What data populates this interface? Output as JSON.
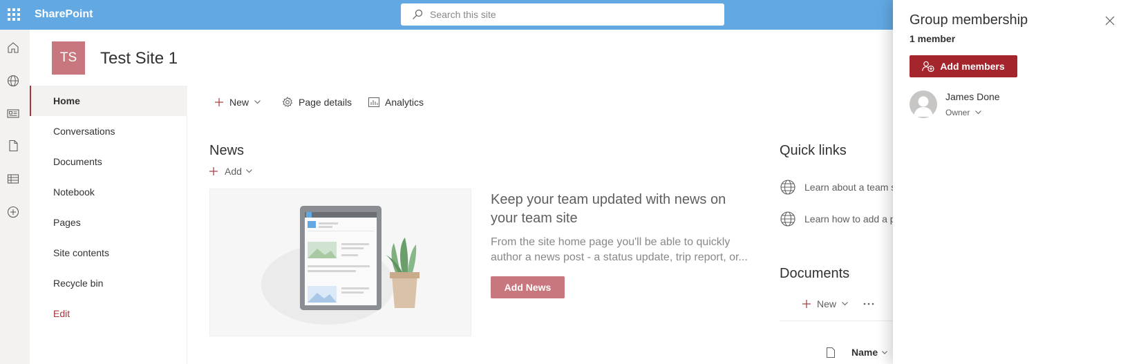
{
  "suite_bar": {
    "app_name": "SharePoint",
    "search_placeholder": "Search this site",
    "icons": [
      "app-launcher-icon",
      "search-icon"
    ],
    "color": "#62a9e4"
  },
  "app_bar": {
    "icons": [
      "home-icon",
      "sites-globe-icon",
      "news-icon",
      "files-icon",
      "lists-icon",
      "create-icon"
    ]
  },
  "site": {
    "logo_initials": "TS",
    "title": "Test Site 1",
    "logo_color": "#c8777e"
  },
  "left_nav": {
    "items": [
      {
        "label": "Home",
        "active": true
      },
      {
        "label": "Conversations"
      },
      {
        "label": "Documents"
      },
      {
        "label": "Notebook"
      },
      {
        "label": "Pages"
      },
      {
        "label": "Site contents"
      },
      {
        "label": "Recycle bin"
      }
    ],
    "edit_label": "Edit"
  },
  "command_bar": {
    "new_label": "New",
    "page_details_label": "Page details",
    "analytics_label": "Analytics"
  },
  "news": {
    "title": "News",
    "add_label": "Add",
    "headline": "Keep your team updated with news on your team site",
    "description": "From the site home page you'll be able to quickly author a news post - a status update, trip report, or...",
    "add_news_button": "Add News"
  },
  "quick_links": {
    "title": "Quick links",
    "items": [
      {
        "label": "Learn about a team s"
      },
      {
        "label": "Learn how to add a p"
      }
    ]
  },
  "documents": {
    "title": "Documents",
    "new_label": "New",
    "more_icon": "more-icon",
    "column_name": "Name"
  },
  "panel": {
    "title": "Group membership",
    "member_count": "1 member",
    "add_members_button": "Add members",
    "members": [
      {
        "name": "James Done",
        "role": "Owner"
      }
    ]
  },
  "colors": {
    "accent": "#a4262c",
    "brand": "#62a9e4"
  }
}
